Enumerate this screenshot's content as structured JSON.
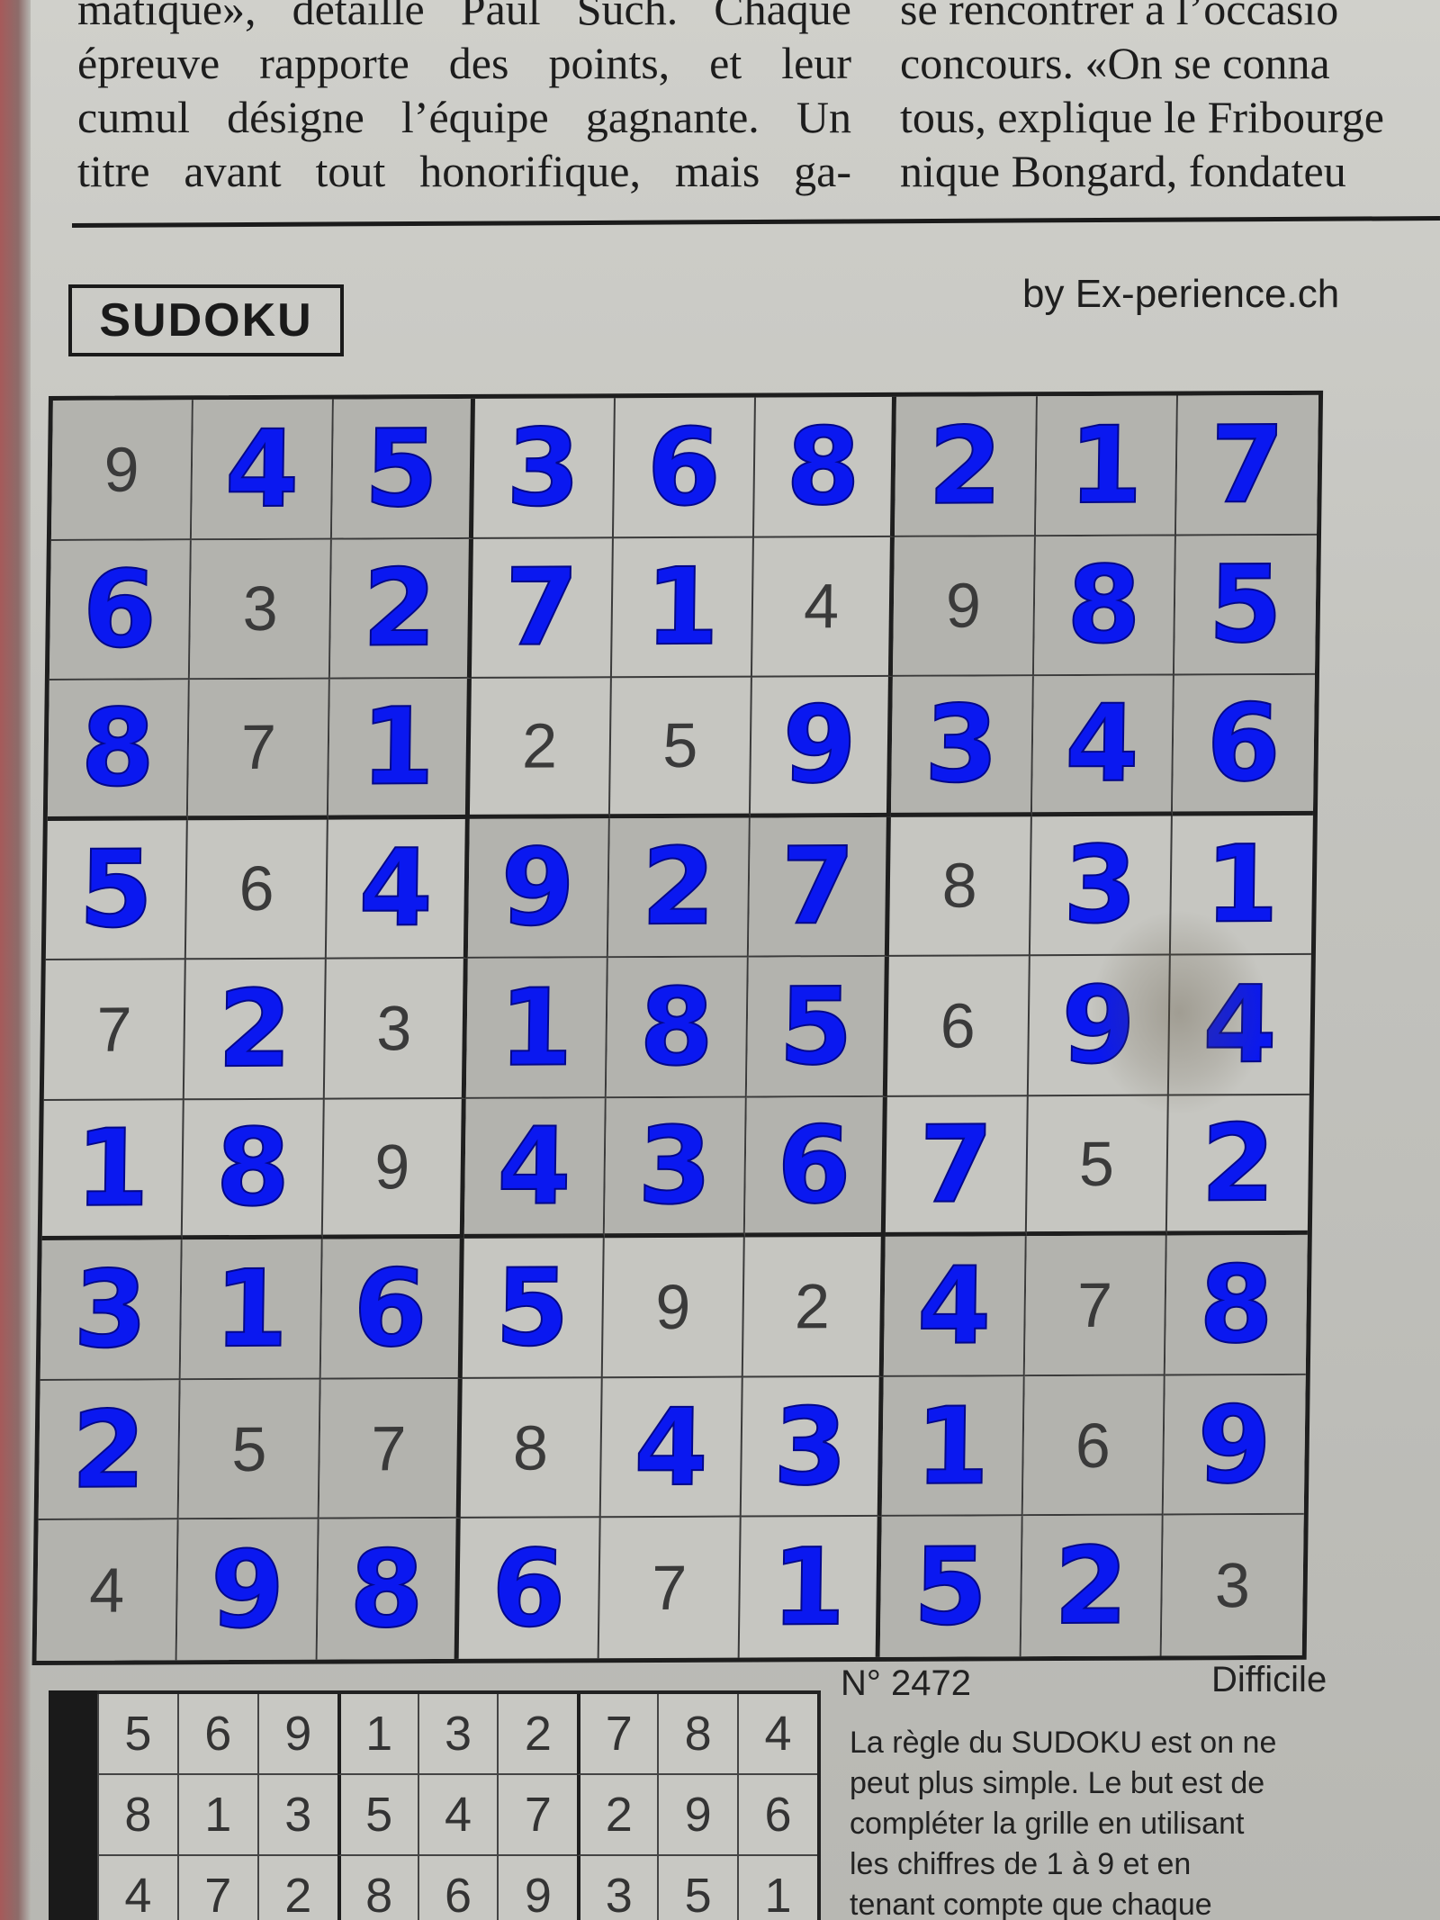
{
  "article": {
    "left_lines": [
      "matique», détaille Paul Such. Chaque",
      "épreuve rapporte des points, et leur",
      "cumul désigne l’équipe gagnante. Un",
      "titre avant tout honorifique, mais ga-"
    ],
    "right_lines": [
      "se rencontrer à l’occasio",
      "concours. «On se conna",
      "tous, explique le Fribourge",
      "nique Bongard, fondateu"
    ]
  },
  "puzzle": {
    "title": "SUDOKU",
    "credit": "by Ex-perience.ch",
    "number": "N° 2472",
    "level": "Difficile",
    "grid": [
      [
        {
          "v": "9",
          "t": "given"
        },
        {
          "v": "4",
          "t": "filled"
        },
        {
          "v": "5",
          "t": "filled"
        },
        {
          "v": "3",
          "t": "filled"
        },
        {
          "v": "6",
          "t": "filled"
        },
        {
          "v": "8",
          "t": "filled"
        },
        {
          "v": "2",
          "t": "filled"
        },
        {
          "v": "1",
          "t": "filled"
        },
        {
          "v": "7",
          "t": "filled"
        }
      ],
      [
        {
          "v": "6",
          "t": "filled"
        },
        {
          "v": "3",
          "t": "given"
        },
        {
          "v": "2",
          "t": "filled"
        },
        {
          "v": "7",
          "t": "filled"
        },
        {
          "v": "1",
          "t": "filled"
        },
        {
          "v": "4",
          "t": "given"
        },
        {
          "v": "9",
          "t": "given"
        },
        {
          "v": "8",
          "t": "filled"
        },
        {
          "v": "5",
          "t": "filled"
        }
      ],
      [
        {
          "v": "8",
          "t": "filled"
        },
        {
          "v": "7",
          "t": "given"
        },
        {
          "v": "1",
          "t": "filled"
        },
        {
          "v": "2",
          "t": "given"
        },
        {
          "v": "5",
          "t": "given"
        },
        {
          "v": "9",
          "t": "filled"
        },
        {
          "v": "3",
          "t": "filled"
        },
        {
          "v": "4",
          "t": "filled"
        },
        {
          "v": "6",
          "t": "filled"
        }
      ],
      [
        {
          "v": "5",
          "t": "filled"
        },
        {
          "v": "6",
          "t": "given"
        },
        {
          "v": "4",
          "t": "filled"
        },
        {
          "v": "9",
          "t": "filled"
        },
        {
          "v": "2",
          "t": "filled"
        },
        {
          "v": "7",
          "t": "filled"
        },
        {
          "v": "8",
          "t": "given"
        },
        {
          "v": "3",
          "t": "filled"
        },
        {
          "v": "1",
          "t": "filled"
        }
      ],
      [
        {
          "v": "7",
          "t": "given"
        },
        {
          "v": "2",
          "t": "filled"
        },
        {
          "v": "3",
          "t": "given"
        },
        {
          "v": "1",
          "t": "filled"
        },
        {
          "v": "8",
          "t": "filled"
        },
        {
          "v": "5",
          "t": "filled"
        },
        {
          "v": "6",
          "t": "given"
        },
        {
          "v": "9",
          "t": "filled"
        },
        {
          "v": "4",
          "t": "filled"
        }
      ],
      [
        {
          "v": "1",
          "t": "filled"
        },
        {
          "v": "8",
          "t": "filled"
        },
        {
          "v": "9",
          "t": "given"
        },
        {
          "v": "4",
          "t": "filled"
        },
        {
          "v": "3",
          "t": "filled"
        },
        {
          "v": "6",
          "t": "filled"
        },
        {
          "v": "7",
          "t": "filled"
        },
        {
          "v": "5",
          "t": "given"
        },
        {
          "v": "2",
          "t": "filled"
        }
      ],
      [
        {
          "v": "3",
          "t": "filled"
        },
        {
          "v": "1",
          "t": "filled"
        },
        {
          "v": "6",
          "t": "filled"
        },
        {
          "v": "5",
          "t": "filled"
        },
        {
          "v": "9",
          "t": "given"
        },
        {
          "v": "2",
          "t": "given"
        },
        {
          "v": "4",
          "t": "filled"
        },
        {
          "v": "7",
          "t": "given"
        },
        {
          "v": "8",
          "t": "filled"
        }
      ],
      [
        {
          "v": "2",
          "t": "filled"
        },
        {
          "v": "5",
          "t": "given"
        },
        {
          "v": "7",
          "t": "given"
        },
        {
          "v": "8",
          "t": "given"
        },
        {
          "v": "4",
          "t": "filled"
        },
        {
          "v": "3",
          "t": "filled"
        },
        {
          "v": "1",
          "t": "filled"
        },
        {
          "v": "6",
          "t": "given"
        },
        {
          "v": "9",
          "t": "filled"
        }
      ],
      [
        {
          "v": "4",
          "t": "given"
        },
        {
          "v": "9",
          "t": "filled"
        },
        {
          "v": "8",
          "t": "filled"
        },
        {
          "v": "6",
          "t": "filled"
        },
        {
          "v": "7",
          "t": "given"
        },
        {
          "v": "1",
          "t": "filled"
        },
        {
          "v": "5",
          "t": "filled"
        },
        {
          "v": "2",
          "t": "filled"
        },
        {
          "v": "3",
          "t": "given"
        }
      ]
    ],
    "previous_solution": [
      [
        "5",
        "6",
        "9",
        "1",
        "3",
        "2",
        "7",
        "8",
        "4"
      ],
      [
        "8",
        "1",
        "3",
        "5",
        "4",
        "7",
        "2",
        "9",
        "6"
      ],
      [
        "4",
        "7",
        "2",
        "8",
        "6",
        "9",
        "3",
        "5",
        "1"
      ]
    ],
    "rules_lines": [
      "La règle du SUDOKU est on ne",
      "peut plus simple. Le but est de",
      "compléter la grille en utilisant",
      "les chiffres de 1 à 9 et en",
      "tenant compte que chaque"
    ]
  }
}
